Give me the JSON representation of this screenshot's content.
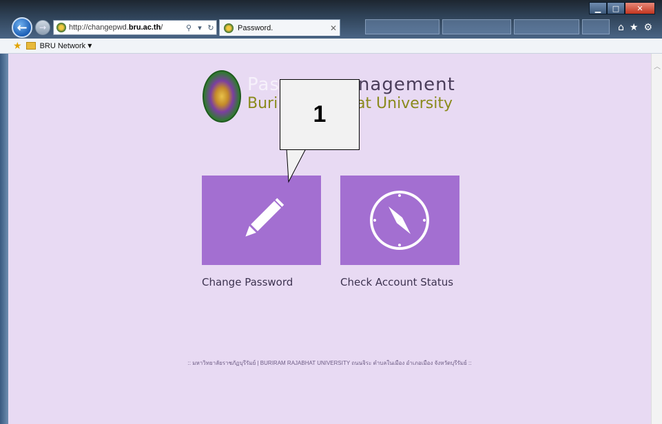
{
  "browser": {
    "url_prefix": "http://changepwd.",
    "url_host": "bru.ac.th",
    "url_suffix": "/",
    "tab_title": "Password.",
    "favorites_label": "BRU Network"
  },
  "page": {
    "logo_line1_left": "Pas",
    "logo_line1_right": "anagement",
    "logo_line2_left": "Buri",
    "logo_line2_right": "hat University",
    "tiles": [
      {
        "label": "Change Password",
        "icon": "pencil-icon"
      },
      {
        "label": "Check Account Status",
        "icon": "compass-icon"
      }
    ],
    "footer": ":: มหาวิทยาลัยราชภัฏบุรีรัมย์ | BURIRAM RAJABHAT UNIVERSITY ถนนจิระ ตำบลในเมือง อำเภอเมือง จังหวัดบุรีรัมย์ ::"
  },
  "annotation": {
    "callout_number": "1"
  },
  "colors": {
    "page_bg": "#e8daf3",
    "tile_bg": "#a36fd1",
    "label_text": "#3d3350",
    "logo_green": "#8a8a1c"
  }
}
